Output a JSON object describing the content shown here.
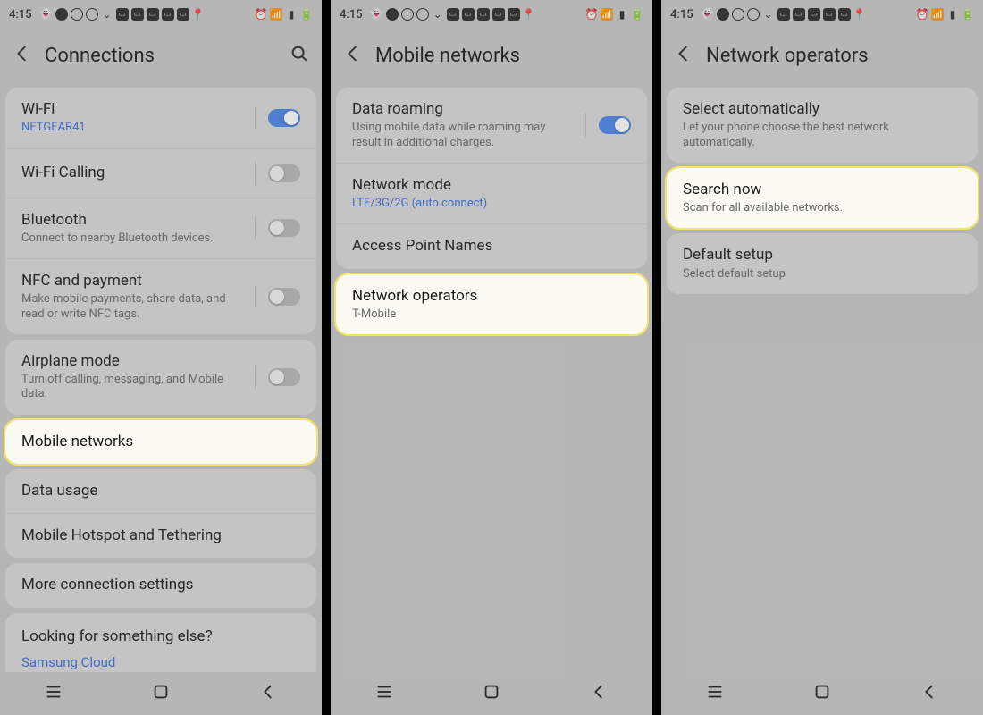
{
  "status": {
    "time": "4:15"
  },
  "screens": [
    {
      "title": "Connections",
      "hasSearch": true,
      "groups": [
        {
          "rows": [
            {
              "id": "wifi",
              "title": "Wi-Fi",
              "sub": "NETGEAR41",
              "subLink": true,
              "toggle": "on"
            },
            {
              "id": "wifi-calling",
              "title": "Wi-Fi Calling",
              "toggle": "off"
            },
            {
              "id": "bluetooth",
              "title": "Bluetooth",
              "sub": "Connect to nearby Bluetooth devices.",
              "toggle": "off"
            },
            {
              "id": "nfc",
              "title": "NFC and payment",
              "sub": "Make mobile payments, share data, and read or write NFC tags.",
              "toggle": "off"
            }
          ]
        },
        {
          "rows": [
            {
              "id": "airplane",
              "title": "Airplane mode",
              "sub": "Turn off calling, messaging, and Mobile data.",
              "toggle": "off"
            }
          ]
        },
        {
          "highlight": true,
          "rows": [
            {
              "id": "mobile-networks",
              "title": "Mobile networks"
            }
          ]
        },
        {
          "rows": [
            {
              "id": "data-usage",
              "title": "Data usage"
            },
            {
              "id": "hotspot",
              "title": "Mobile Hotspot and Tethering"
            }
          ]
        },
        {
          "rows": [
            {
              "id": "more-conn",
              "title": "More connection settings"
            }
          ]
        }
      ],
      "looking": {
        "title": "Looking for something else?",
        "link": "Samsung Cloud"
      }
    },
    {
      "title": "Mobile networks",
      "groups": [
        {
          "rows": [
            {
              "id": "data-roaming",
              "title": "Data roaming",
              "sub": "Using mobile data while roaming may result in additional charges.",
              "toggle": "on"
            },
            {
              "id": "network-mode",
              "title": "Network mode",
              "sub": "LTE/3G/2G (auto connect)",
              "subLink": true
            },
            {
              "id": "apn",
              "title": "Access Point Names"
            }
          ]
        },
        {
          "highlight": true,
          "rows": [
            {
              "id": "network-operators",
              "title": "Network operators",
              "sub": "T-Mobile"
            }
          ]
        }
      ]
    },
    {
      "title": "Network operators",
      "groups": [
        {
          "rows": [
            {
              "id": "select-auto",
              "title": "Select automatically",
              "sub": "Let your phone choose the best network automatically."
            }
          ]
        },
        {
          "highlight": true,
          "rows": [
            {
              "id": "search-now",
              "title": "Search now",
              "sub": "Scan for all available networks."
            }
          ]
        },
        {
          "rows": [
            {
              "id": "default-setup",
              "title": "Default setup",
              "sub": "Select default setup"
            }
          ]
        }
      ]
    }
  ]
}
